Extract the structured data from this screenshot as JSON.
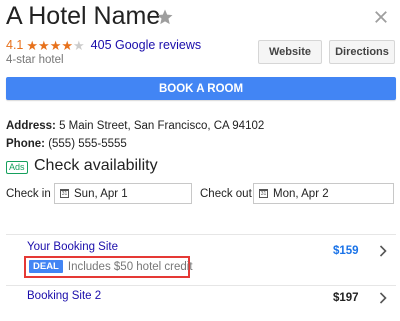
{
  "hotel": {
    "name": "A Hotel Name",
    "rating_value": "4.1",
    "rating_stars": 4.1,
    "reviews_label": "405 Google reviews",
    "hotel_class": "4-star hotel"
  },
  "actions": {
    "website_label": "Website",
    "directions_label": "Directions",
    "book_label": "BOOK A ROOM"
  },
  "details": {
    "address_label": "Address:",
    "address_value": "5 Main Street, San Francisco, CA 94102",
    "phone_label": "Phone:",
    "phone_value": "(555) 555-5555"
  },
  "availability": {
    "ads_badge": "Ads",
    "title": "Check availability",
    "check_in_label": "Check in",
    "check_in_value": "Sun, Apr 1",
    "check_out_label": "Check out",
    "check_out_value": "Mon, Apr 2",
    "calendar_icon_text": "31"
  },
  "booking_sites": [
    {
      "name": "Your Booking Site",
      "price": "$159",
      "deal_badge": "DEAL",
      "deal_text": "Includes $50 hotel credit"
    },
    {
      "name": "Booking Site 2",
      "price": "$197"
    }
  ],
  "colors": {
    "accent": "#4285f4",
    "link": "#1a0dab",
    "star": "#e7711b",
    "highlight_box": "#e53935",
    "ads_green": "#16a05d"
  },
  "icons": {
    "star": "star-icon",
    "close": "close-icon",
    "calendar": "calendar-icon",
    "chevron": "chevron-right-icon"
  }
}
